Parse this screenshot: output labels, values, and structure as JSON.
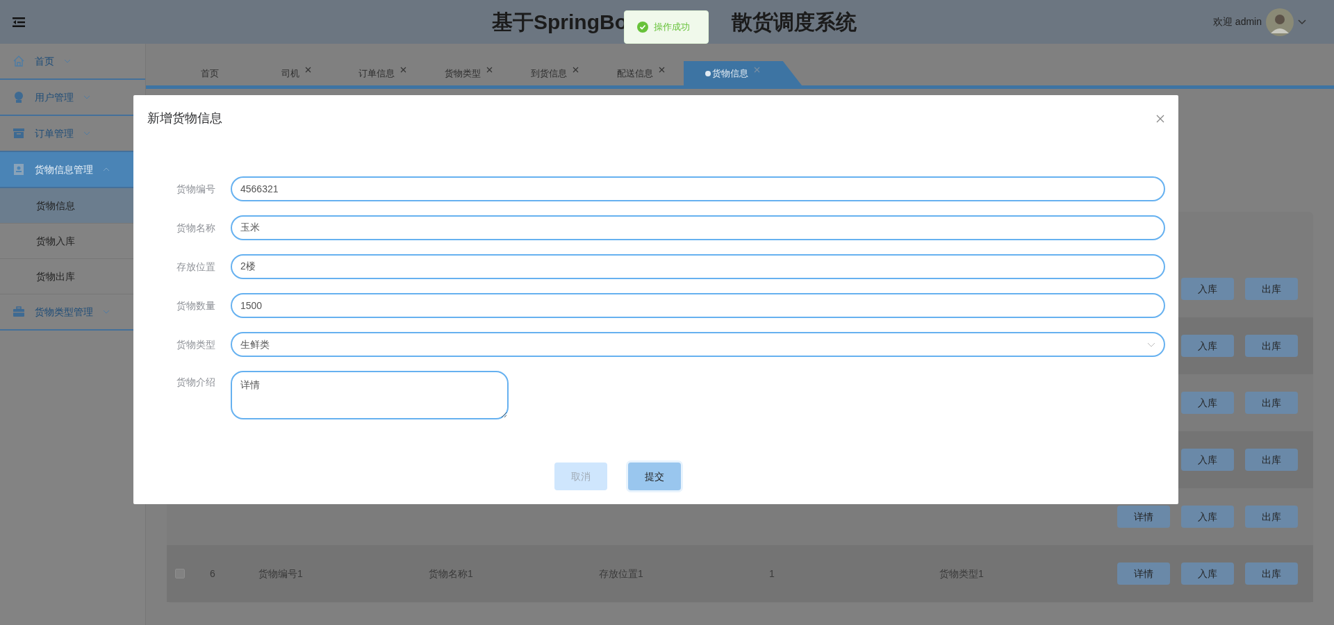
{
  "header": {
    "title_left": "基于SpringBo",
    "title_right": "散货调度系统",
    "welcome": "欢迎 admin"
  },
  "toast": {
    "message": "操作成功"
  },
  "sidebar": {
    "items": [
      {
        "label": "首页",
        "kind": "home",
        "expanded": false,
        "selected": false
      },
      {
        "label": "用户管理",
        "kind": "user",
        "expanded": false,
        "selected": false
      },
      {
        "label": "订单管理",
        "kind": "archive",
        "expanded": false,
        "selected": false
      },
      {
        "label": "货物信息管理",
        "kind": "card",
        "expanded": true,
        "selected": true,
        "children": [
          {
            "label": "货物信息",
            "selected": true
          },
          {
            "label": "货物入库",
            "selected": false
          },
          {
            "label": "货物出库",
            "selected": false
          }
        ]
      },
      {
        "label": "货物类型管理",
        "kind": "briefcase",
        "expanded": false,
        "selected": false
      }
    ]
  },
  "tabs": [
    {
      "label": "首页",
      "closable": false,
      "selected": false
    },
    {
      "label": "司机",
      "closable": true,
      "selected": false
    },
    {
      "label": "订单信息",
      "closable": true,
      "selected": false
    },
    {
      "label": "货物类型",
      "closable": true,
      "selected": false
    },
    {
      "label": "到货信息",
      "closable": true,
      "selected": false
    },
    {
      "label": "配送信息",
      "closable": true,
      "selected": false
    },
    {
      "label": "货物信息",
      "closable": true,
      "selected": true
    }
  ],
  "table": {
    "rows": [
      {
        "buttons": [
          "入库",
          "出库"
        ]
      },
      {
        "buttons": [
          "入库",
          "出库"
        ]
      },
      {
        "buttons": [
          "入库",
          "出库"
        ]
      },
      {
        "buttons": [
          "入库",
          "出库"
        ]
      },
      {
        "buttons": [
          "详情",
          "入库",
          "出库"
        ]
      },
      {
        "checked": false,
        "cells": [
          "6",
          "货物编号1",
          "货物名称1",
          "存放位置1",
          "1",
          "货物类型1"
        ],
        "buttons": [
          "详情",
          "入库",
          "出库"
        ]
      }
    ]
  },
  "dialog": {
    "title": "新增货物信息",
    "fields": [
      {
        "label": "货物编号",
        "value": "4566321",
        "kind": "input"
      },
      {
        "label": "货物名称",
        "value": "玉米",
        "kind": "input"
      },
      {
        "label": "存放位置",
        "value": "2楼",
        "kind": "input"
      },
      {
        "label": "货物数量",
        "value": "1500",
        "kind": "input"
      },
      {
        "label": "货物类型",
        "value": "生鲜类",
        "kind": "select"
      },
      {
        "label": "货物介绍",
        "value": "详情",
        "kind": "textarea"
      }
    ],
    "buttons": [
      {
        "label": "取消",
        "kind": "cancel"
      },
      {
        "label": "提交",
        "kind": "submit"
      }
    ]
  }
}
